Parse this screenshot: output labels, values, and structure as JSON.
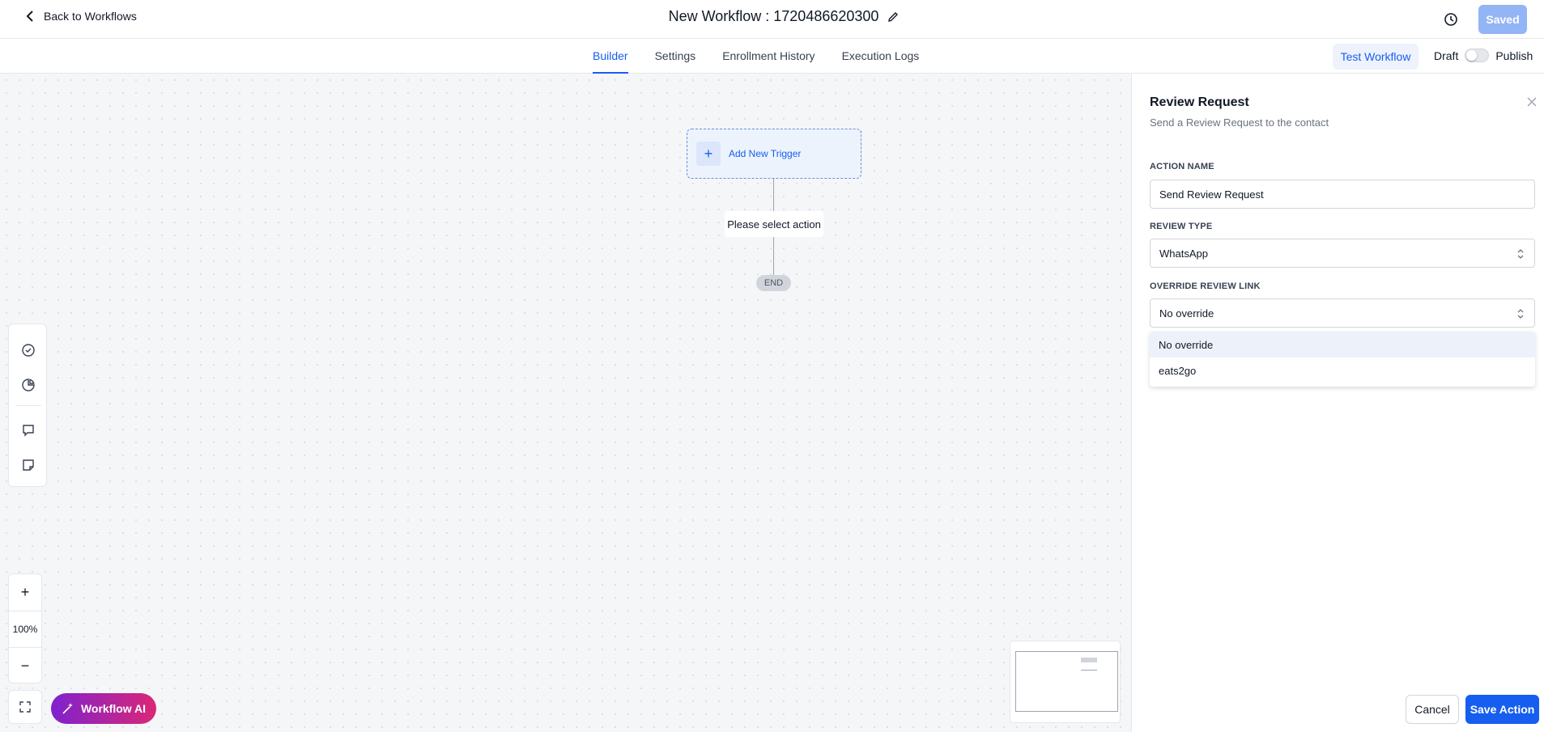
{
  "header": {
    "back_label": "Back to Workflows",
    "workflow_title": "New Workflow : 1720486620300",
    "saved_label": "Saved",
    "icons": {
      "back": "chevron-left-icon",
      "edit": "pencil-icon",
      "history": "history-icon"
    }
  },
  "tabs": [
    {
      "label": "Builder",
      "active": true
    },
    {
      "label": "Settings",
      "active": false
    },
    {
      "label": "Enrollment History",
      "active": false
    },
    {
      "label": "Execution Logs",
      "active": false
    }
  ],
  "toolbar": {
    "test_workflow_label": "Test Workflow",
    "draft_label": "Draft",
    "publish_label": "Publish",
    "publish_toggle_on": false
  },
  "canvas": {
    "trigger_label": "Add New Trigger",
    "action_label": "Please select action",
    "end_label": "END",
    "zoom_level": "100%",
    "zoom_in": "+",
    "zoom_out": "−",
    "workflow_ai_label": "Workflow AI"
  },
  "panel": {
    "title": "Review Request",
    "subtitle": "Send a Review Request to the contact",
    "action_name_label": "ACTION NAME",
    "action_name_value": "Send Review Request",
    "review_type_label": "REVIEW TYPE",
    "review_type_value": "WhatsApp",
    "override_label": "OVERRIDE REVIEW LINK",
    "override_value": "No override",
    "override_options": [
      "No override",
      "eats2go"
    ],
    "cancel_label": "Cancel",
    "save_label": "Save Action"
  },
  "colors": {
    "accent": "#155eef",
    "saved_button": "#93b4f5",
    "ai_gradient_start": "#7e22ce",
    "ai_gradient_end": "#db2777"
  }
}
